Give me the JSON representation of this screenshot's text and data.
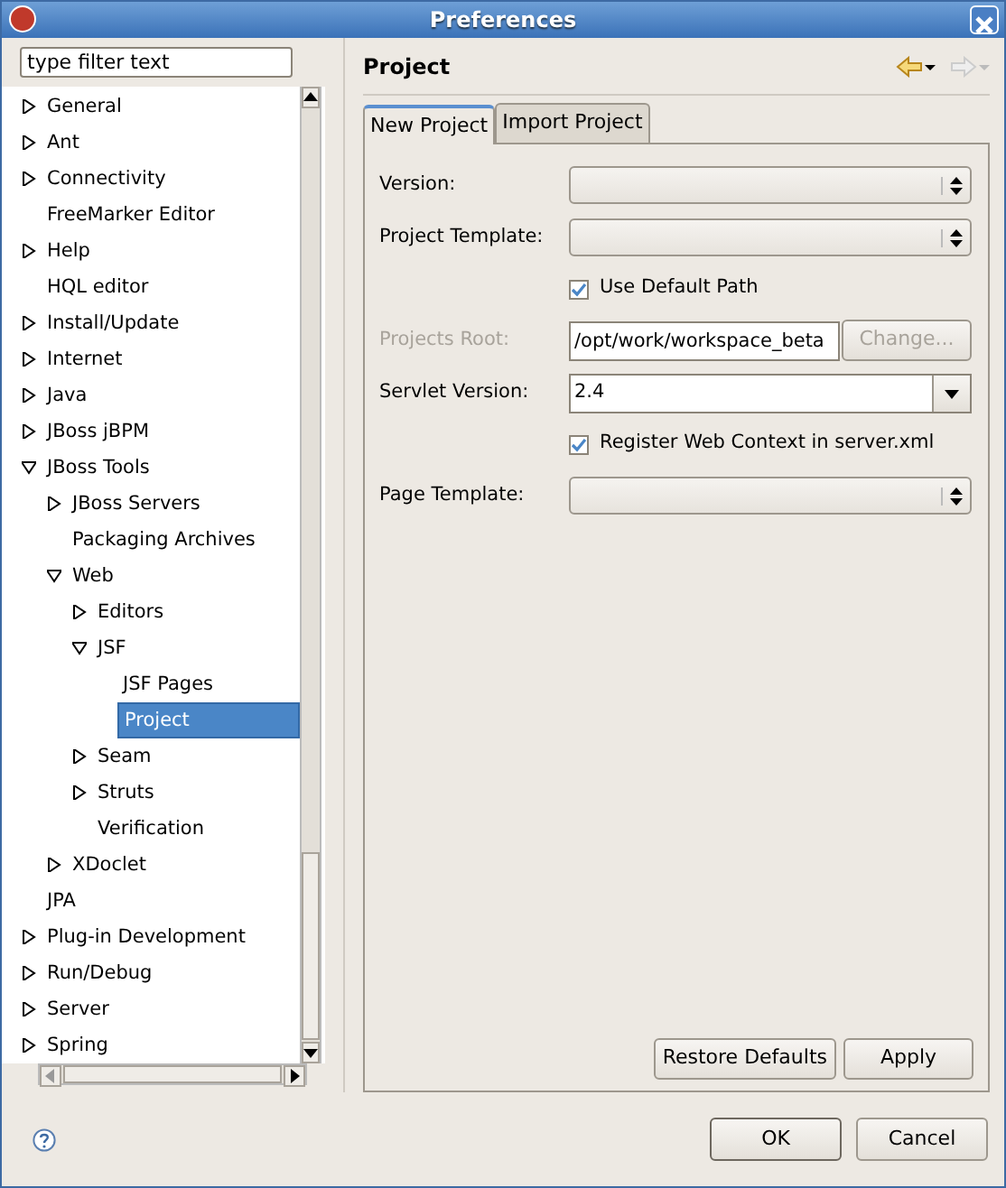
{
  "window": {
    "title": "Preferences"
  },
  "filter": {
    "placeholder": "type filter text"
  },
  "tree": [
    {
      "label": "General",
      "kind": "folder",
      "expanded": false,
      "selected": false
    },
    {
      "label": "Ant",
      "kind": "folder",
      "expanded": false,
      "selected": false
    },
    {
      "label": "Connectivity",
      "kind": "folder",
      "expanded": false,
      "selected": false
    },
    {
      "label": "FreeMarker Editor",
      "kind": "leaf",
      "selected": false
    },
    {
      "label": "Help",
      "kind": "folder",
      "expanded": false,
      "selected": false
    },
    {
      "label": "HQL editor",
      "kind": "leaf",
      "selected": false
    },
    {
      "label": "Install/Update",
      "kind": "folder",
      "expanded": false,
      "selected": false
    },
    {
      "label": "Internet",
      "kind": "folder",
      "expanded": false,
      "selected": false
    },
    {
      "label": "Java",
      "kind": "folder",
      "expanded": false,
      "selected": false
    },
    {
      "label": "JBoss jBPM",
      "kind": "folder",
      "expanded": false,
      "selected": false
    },
    {
      "label": "JBoss Tools",
      "kind": "folder",
      "expanded": true,
      "selected": false,
      "children": [
        {
          "label": "JBoss Servers",
          "kind": "folder",
          "expanded": false,
          "selected": false
        },
        {
          "label": "Packaging Archives",
          "kind": "leaf",
          "selected": false
        },
        {
          "label": "Web",
          "kind": "folder",
          "expanded": true,
          "selected": false,
          "children": [
            {
              "label": "Editors",
              "kind": "folder",
              "expanded": false,
              "selected": false
            },
            {
              "label": "JSF",
              "kind": "folder",
              "expanded": true,
              "selected": false,
              "children": [
                {
                  "label": "JSF Pages",
                  "kind": "leaf",
                  "selected": false
                },
                {
                  "label": "Project",
                  "kind": "leaf",
                  "selected": true
                }
              ]
            },
            {
              "label": "Seam",
              "kind": "folder",
              "expanded": false,
              "selected": false
            },
            {
              "label": "Struts",
              "kind": "folder",
              "expanded": false,
              "selected": false
            },
            {
              "label": "Verification",
              "kind": "leaf",
              "selected": false
            }
          ]
        },
        {
          "label": "XDoclet",
          "kind": "folder",
          "expanded": false,
          "selected": false
        }
      ]
    },
    {
      "label": "JPA",
      "kind": "leaf",
      "selected": false
    },
    {
      "label": "Plug-in Development",
      "kind": "folder",
      "expanded": false,
      "selected": false
    },
    {
      "label": "Run/Debug",
      "kind": "folder",
      "expanded": false,
      "selected": false
    },
    {
      "label": "Server",
      "kind": "folder",
      "expanded": false,
      "selected": false
    },
    {
      "label": "Spring",
      "kind": "folder",
      "expanded": false,
      "selected": false
    }
  ],
  "page": {
    "title": "Project",
    "tabs": [
      {
        "label": "New Project",
        "selected": true
      },
      {
        "label": "Import Project",
        "selected": false
      }
    ],
    "fields": [
      {
        "kind": "combo",
        "label": "Version:"
      },
      {
        "kind": "combo",
        "label": "Project Template:"
      },
      {
        "kind": "checkbox",
        "label": "Use Default Path",
        "checked": true
      },
      {
        "kind": "path",
        "label": "Projects Root:",
        "value": "/opt/work/workspace_beta",
        "button": "Change...",
        "disabled": true
      },
      {
        "kind": "dropdown",
        "label": "Servlet Version:",
        "value": "2.4"
      },
      {
        "kind": "checkbox",
        "label": "Register Web Context in server.xml",
        "checked": true
      },
      {
        "kind": "combo",
        "label": "Page Template:"
      }
    ],
    "buttons": [
      "Restore Defaults",
      "Apply"
    ]
  },
  "dialog_buttons": [
    "OK",
    "Cancel"
  ]
}
